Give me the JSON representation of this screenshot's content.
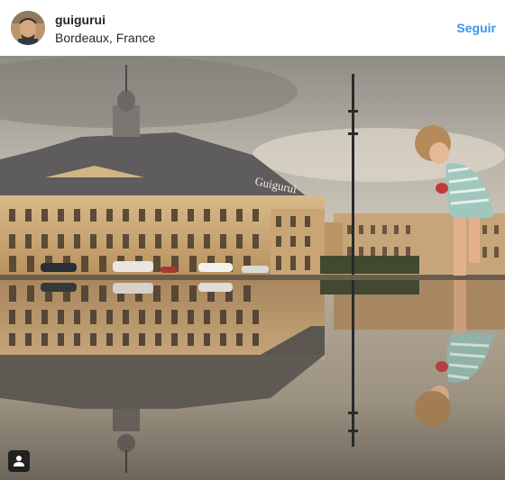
{
  "post": {
    "username": "guigurui",
    "location": "Bordeaux, France",
    "follow_label": "Seguir"
  },
  "photo": {
    "building_sign": "Guigurui"
  },
  "icons": {
    "avatar": "profile-avatar",
    "tag": "person-tag-icon"
  }
}
